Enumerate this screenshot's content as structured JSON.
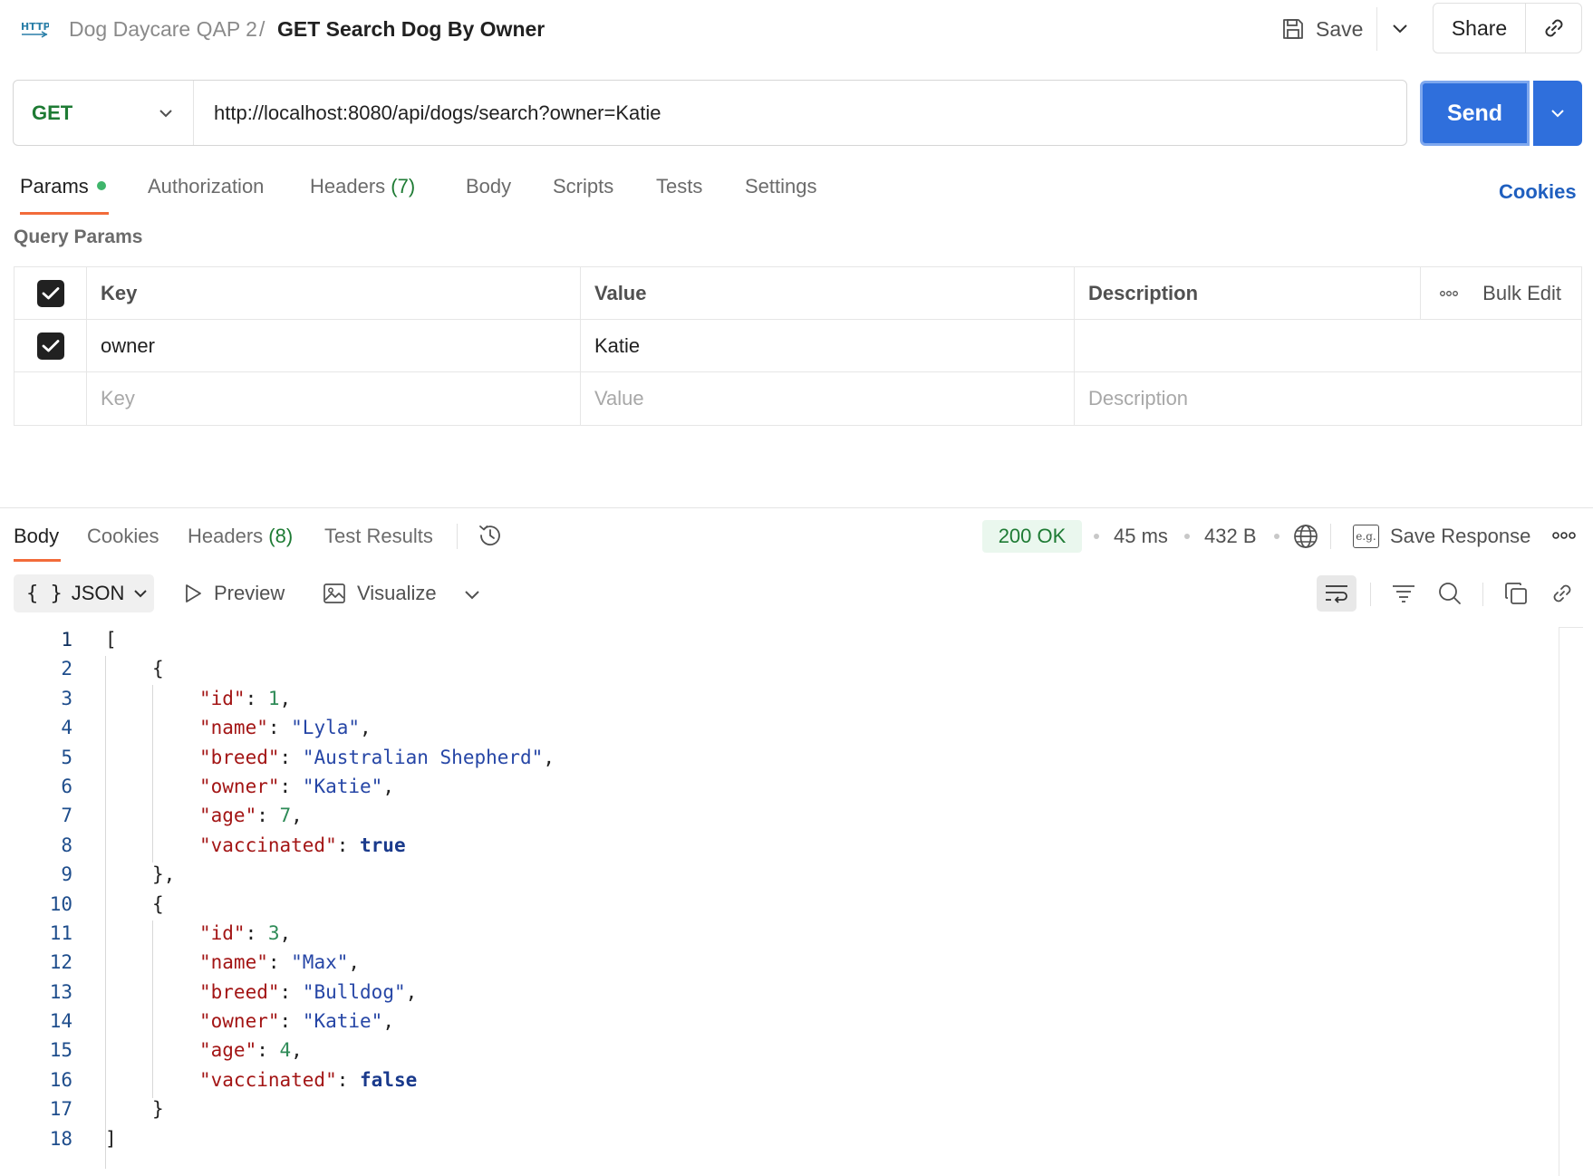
{
  "header": {
    "icon": "http-icon",
    "collection": "Dog Daycare QAP 2",
    "separator": "/",
    "request_name": "GET Search Dog By Owner",
    "save_label": "Save",
    "share_label": "Share"
  },
  "request": {
    "method": "GET",
    "url": "http://localhost:8080/api/dogs/search?owner=Katie",
    "send_label": "Send"
  },
  "request_tabs": {
    "params": "Params",
    "authorization": "Authorization",
    "headers": "Headers",
    "headers_count": "(7)",
    "body": "Body",
    "scripts": "Scripts",
    "tests": "Tests",
    "settings": "Settings",
    "cookies": "Cookies"
  },
  "query_params": {
    "title": "Query Params",
    "columns": {
      "key": "Key",
      "value": "Value",
      "description": "Description",
      "bulk_edit": "Bulk Edit"
    },
    "rows": [
      {
        "checked": true,
        "key": "owner",
        "value": "Katie",
        "description": ""
      }
    ],
    "placeholders": {
      "key": "Key",
      "value": "Value",
      "description": "Description"
    }
  },
  "response": {
    "tabs": {
      "body": "Body",
      "cookies": "Cookies",
      "headers": "Headers",
      "headers_count": "(8)",
      "test_results": "Test Results"
    },
    "status": "200 OK",
    "time": "45 ms",
    "size": "432 B",
    "save_response": "Save Response",
    "format": "JSON",
    "preview": "Preview",
    "visualize": "Visualize",
    "colors": {
      "status_green": "#1e7b34",
      "send_blue": "#2f6fdc",
      "tab_accent": "#f26b3a"
    },
    "lines": [
      {
        "n": "1",
        "indent": 0,
        "parts": [
          [
            "p",
            "["
          ]
        ]
      },
      {
        "n": "2",
        "indent": 1,
        "parts": [
          [
            "p",
            "{"
          ]
        ]
      },
      {
        "n": "3",
        "indent": 2,
        "parts": [
          [
            "k",
            "\"id\""
          ],
          [
            "p",
            ": "
          ],
          [
            "n",
            "1"
          ],
          [
            "p",
            ","
          ]
        ]
      },
      {
        "n": "4",
        "indent": 2,
        "parts": [
          [
            "k",
            "\"name\""
          ],
          [
            "p",
            ": "
          ],
          [
            "s",
            "\"Lyla\""
          ],
          [
            "p",
            ","
          ]
        ]
      },
      {
        "n": "5",
        "indent": 2,
        "parts": [
          [
            "k",
            "\"breed\""
          ],
          [
            "p",
            ": "
          ],
          [
            "s",
            "\"Australian Shepherd\""
          ],
          [
            "p",
            ","
          ]
        ]
      },
      {
        "n": "6",
        "indent": 2,
        "parts": [
          [
            "k",
            "\"owner\""
          ],
          [
            "p",
            ": "
          ],
          [
            "s",
            "\"Katie\""
          ],
          [
            "p",
            ","
          ]
        ]
      },
      {
        "n": "7",
        "indent": 2,
        "parts": [
          [
            "k",
            "\"age\""
          ],
          [
            "p",
            ": "
          ],
          [
            "n",
            "7"
          ],
          [
            "p",
            ","
          ]
        ]
      },
      {
        "n": "8",
        "indent": 2,
        "parts": [
          [
            "k",
            "\"vaccinated\""
          ],
          [
            "p",
            ": "
          ],
          [
            "b",
            "true"
          ]
        ]
      },
      {
        "n": "9",
        "indent": 1,
        "parts": [
          [
            "p",
            "},"
          ]
        ]
      },
      {
        "n": "10",
        "indent": 1,
        "parts": [
          [
            "p",
            "{"
          ]
        ]
      },
      {
        "n": "11",
        "indent": 2,
        "parts": [
          [
            "k",
            "\"id\""
          ],
          [
            "p",
            ": "
          ],
          [
            "n",
            "3"
          ],
          [
            "p",
            ","
          ]
        ]
      },
      {
        "n": "12",
        "indent": 2,
        "parts": [
          [
            "k",
            "\"name\""
          ],
          [
            "p",
            ": "
          ],
          [
            "s",
            "\"Max\""
          ],
          [
            "p",
            ","
          ]
        ]
      },
      {
        "n": "13",
        "indent": 2,
        "parts": [
          [
            "k",
            "\"breed\""
          ],
          [
            "p",
            ": "
          ],
          [
            "s",
            "\"Bulldog\""
          ],
          [
            "p",
            ","
          ]
        ]
      },
      {
        "n": "14",
        "indent": 2,
        "parts": [
          [
            "k",
            "\"owner\""
          ],
          [
            "p",
            ": "
          ],
          [
            "s",
            "\"Katie\""
          ],
          [
            "p",
            ","
          ]
        ]
      },
      {
        "n": "15",
        "indent": 2,
        "parts": [
          [
            "k",
            "\"age\""
          ],
          [
            "p",
            ": "
          ],
          [
            "n",
            "4"
          ],
          [
            "p",
            ","
          ]
        ]
      },
      {
        "n": "16",
        "indent": 2,
        "parts": [
          [
            "k",
            "\"vaccinated\""
          ],
          [
            "p",
            ": "
          ],
          [
            "b",
            "false"
          ]
        ]
      },
      {
        "n": "17",
        "indent": 1,
        "parts": [
          [
            "p",
            "}"
          ]
        ]
      },
      {
        "n": "18",
        "indent": 0,
        "parts": [
          [
            "p",
            "]"
          ]
        ]
      }
    ]
  }
}
